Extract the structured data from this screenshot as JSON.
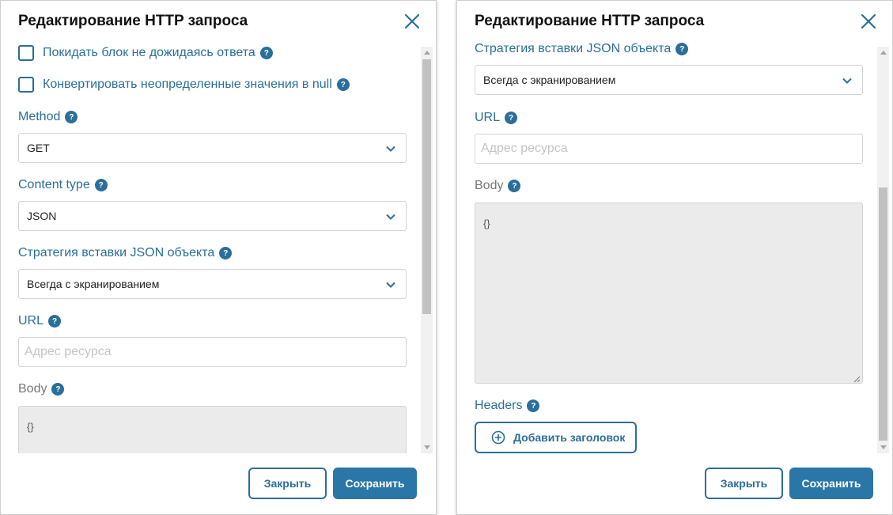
{
  "left": {
    "title": "Редактирование HTTP запроса",
    "checkboxes": [
      {
        "label": "Покидать блок не дожидаясь ответа"
      },
      {
        "label": "Конвертировать неопределенные значения в null"
      }
    ],
    "method": {
      "label": "Method",
      "value": "GET"
    },
    "content_type": {
      "label": "Content type",
      "value": "JSON"
    },
    "json_strategy": {
      "label": "Стратегия вставки JSON объекта",
      "value": "Всегда с экранированием"
    },
    "url": {
      "label": "URL",
      "placeholder": "Адрес ресурса"
    },
    "body": {
      "label": "Body",
      "value": "{}"
    },
    "buttons": {
      "close": "Закрыть",
      "save": "Сохранить"
    }
  },
  "right": {
    "title": "Редактирование HTTP запроса",
    "json_strategy": {
      "label": "Стратегия вставки JSON объекта",
      "value": "Всегда с экранированием"
    },
    "url": {
      "label": "URL",
      "placeholder": "Адрес ресурса"
    },
    "body": {
      "label": "Body",
      "value": "{}"
    },
    "headers": {
      "label": "Headers",
      "add_button": "Добавить заголовок"
    },
    "buttons": {
      "close": "Закрыть",
      "save": "Сохранить"
    }
  },
  "help_icon_glyph": "?",
  "colors": {
    "accent": "#2a6f99",
    "save_button": "#2a76a6",
    "label_gray": "#777777",
    "textarea_bg": "#ebebeb"
  },
  "icons": [
    "close-icon",
    "chevron-down-icon",
    "help-icon",
    "plus-circle-icon"
  ]
}
